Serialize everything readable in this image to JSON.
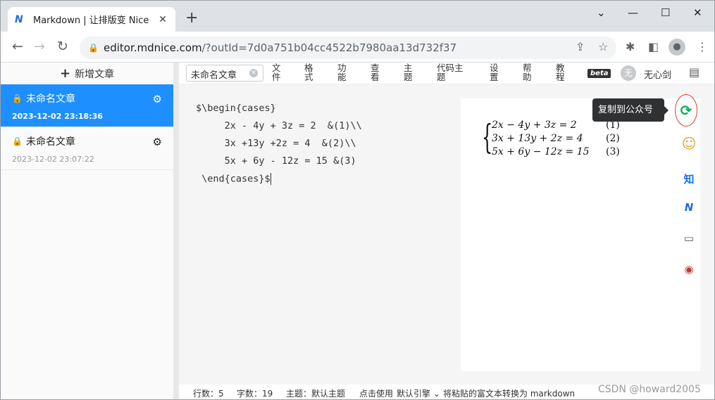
{
  "browser": {
    "tab_title": "Markdown | 让排版变 Nice",
    "tab_favicon": "mdnice-logo-icon",
    "url_host": "editor.mdnice.com",
    "url_path": "/?outId=7d0a751b04cc4522b7980aa13d732f37"
  },
  "sidebar": {
    "new_article_label": "新增文章",
    "articles": [
      {
        "name": "未命名文章",
        "date": "2023-12-02 23:18:36",
        "active": true
      },
      {
        "name": "未命名文章",
        "date": "2023-12-02 23:07:22",
        "active": false
      }
    ]
  },
  "menubar": {
    "doc_name": "未命名文章",
    "items": [
      {
        "l1": "文",
        "l2": "件"
      },
      {
        "l1": "格",
        "l2": "式"
      },
      {
        "l1": "功",
        "l2": "能"
      },
      {
        "l1": "查",
        "l2": "看"
      },
      {
        "l1": "主",
        "l2": "题"
      },
      {
        "l1": "代码主",
        "l2": "题"
      },
      {
        "l1": "设",
        "l2": "置"
      },
      {
        "l1": "帮",
        "l2": "助"
      },
      {
        "l1": "教",
        "l2": "程"
      }
    ],
    "beta_label": "beta",
    "avatar_text": "无",
    "username": "无心剑"
  },
  "editor": {
    "lines": [
      "$\\begin{cases}",
      "     2x - 4y + 3z = 2  &(1)\\\\",
      "     3x +13y +2z = 4  &(2)\\\\",
      "     5x + 6y - 12z = 15 &(3)",
      " \\end{cases}$"
    ]
  },
  "preview": {
    "rows": [
      {
        "expr": "2x − 4y + 3z = 2",
        "num": "(1)"
      },
      {
        "expr": "3x + 13y + 2z = 4",
        "num": "(2)"
      },
      {
        "expr": "5x + 6y − 12z = 15",
        "num": "(3)"
      }
    ]
  },
  "sidetools": {
    "tooltip": "复制到公众号",
    "zhihu_label": "知"
  },
  "statusbar": {
    "lines": "行数：5",
    "chars": "字数：19",
    "theme": "主题：默认主题",
    "click_use": "点击使用",
    "engine": "默认引擎",
    "convert": "将粘贴的富文本转换为 markdown"
  },
  "watermark": "CSDN @howard2005"
}
